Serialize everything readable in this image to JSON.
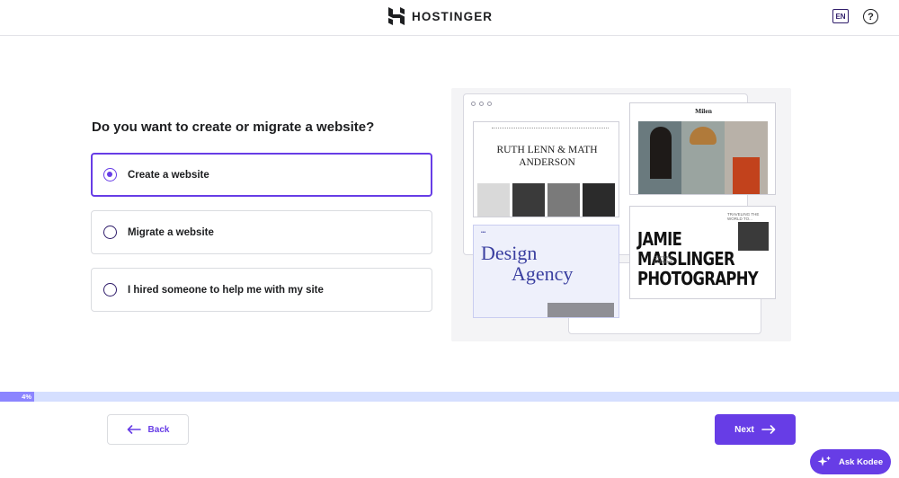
{
  "header": {
    "brand": "HOSTINGER",
    "language": "EN",
    "help_symbol": "?",
    "logo_icon": "hostinger-h-icon",
    "help_icon": "question-circle-icon"
  },
  "main": {
    "question": "Do you want to create or migrate a website?",
    "options": [
      {
        "label": "Create a website",
        "selected": true
      },
      {
        "label": "Migrate a website",
        "selected": false
      },
      {
        "label": "I hired someone to help me with my site",
        "selected": false
      }
    ]
  },
  "illustration": {
    "card1_title": "RUTH LENN & MATH ANDERSON",
    "card2_title": "Milen",
    "card3_title_line1": "Design",
    "card3_title_line2": "Agency",
    "card4_line1": "JAMIE",
    "card4_line2": "MAISLINGER",
    "card4_line3": "PHOTOGRAPHY",
    "card4_side1": "TRAVELING THE WORLD TO...",
    "card4_side2": "CAPTURE EXTREME"
  },
  "progress": {
    "label": "4%",
    "value": 0.04
  },
  "footer": {
    "back_label": "Back",
    "next_label": "Next",
    "kodee_label": "Ask Kodee"
  },
  "colors": {
    "accent": "#673de6",
    "progress_track": "#d5dfff",
    "progress_fill": "#8c85ff"
  }
}
